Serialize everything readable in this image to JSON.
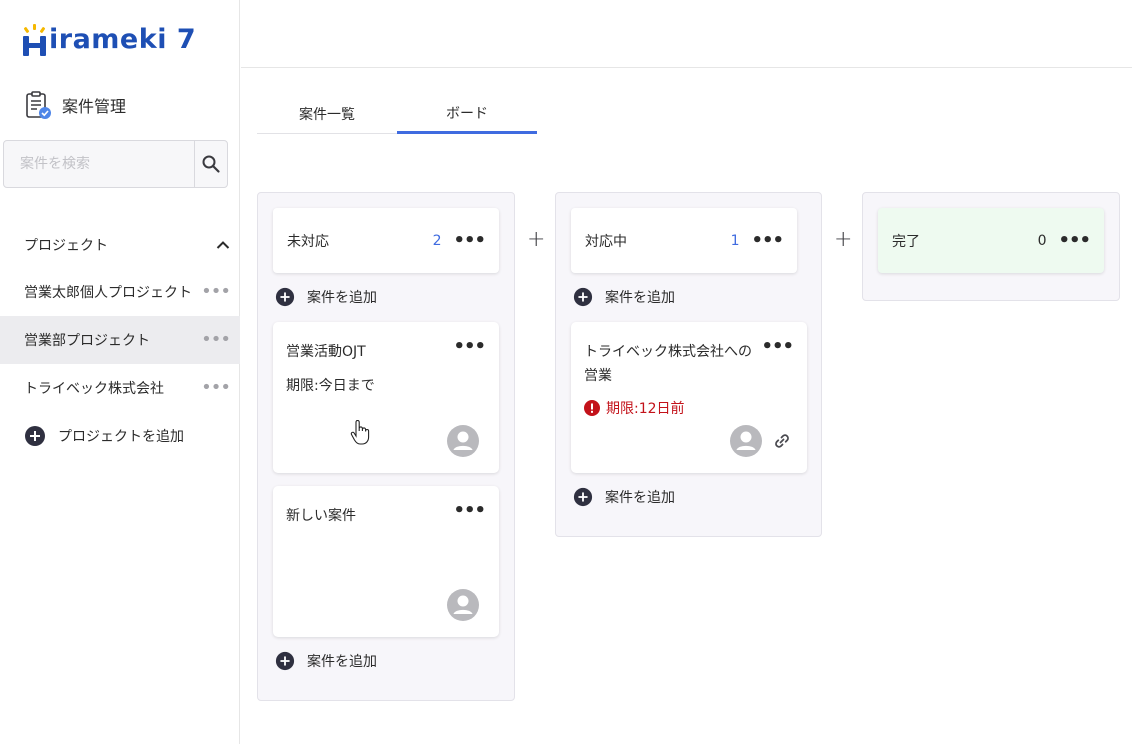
{
  "app": {
    "logo_text": "irameki 7"
  },
  "sidebar": {
    "section_label": "案件管理",
    "search_placeholder": "案件を検索",
    "projects_header": "プロジェクト",
    "projects": [
      {
        "label": "営業太郎個人プロジェクト",
        "active": false
      },
      {
        "label": "営業部プロジェクト",
        "active": true
      },
      {
        "label": "トライベック株式会社",
        "active": false
      }
    ],
    "add_project_label": "プロジェクトを追加"
  },
  "tabs": [
    {
      "label": "案件一覧",
      "active": false
    },
    {
      "label": "ボード",
      "active": true
    }
  ],
  "board": {
    "add_case_label": "案件を追加",
    "columns": [
      {
        "title": "未対応",
        "count": "2",
        "cards": [
          {
            "title": "営業活動OJT",
            "due": "期限:今日まで",
            "overdue": false
          },
          {
            "title": "新しい案件",
            "due": "",
            "overdue": false
          }
        ]
      },
      {
        "title": "対応中",
        "count": "1",
        "cards": [
          {
            "title": "トライベック株式会社への営業",
            "due": "期限:12日前",
            "overdue": true
          }
        ]
      },
      {
        "title": "完了",
        "count": "0",
        "cards": []
      }
    ]
  },
  "colors": {
    "accent": "#3f6be0",
    "logo": "#1e4fb4",
    "overdue": "#c3121a",
    "done_header": "#eefaf0"
  }
}
